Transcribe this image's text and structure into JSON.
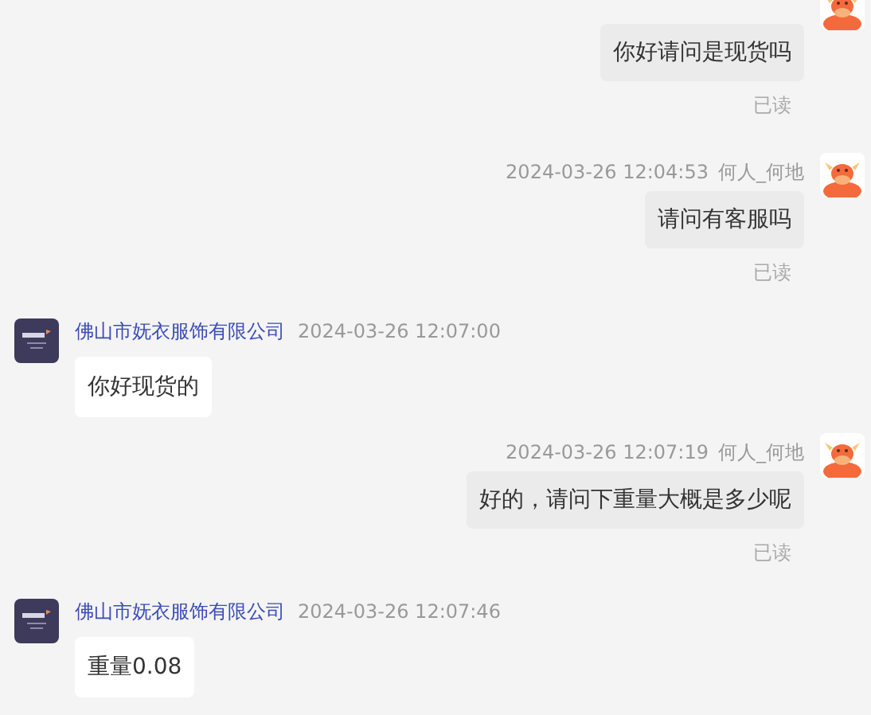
{
  "messages": [
    {
      "kind": "outgoing",
      "text": "你好请问是现货吗",
      "status": "已读"
    },
    {
      "kind": "outgoing",
      "time": "2024-03-26 12:04:53",
      "name": "何人_何地",
      "text": "请问有客服吗",
      "status": "已读"
    },
    {
      "kind": "incoming",
      "name": "佛山市妩衣服饰有限公司",
      "time": "2024-03-26 12:07:00",
      "text": "你好现货的"
    },
    {
      "kind": "outgoing",
      "time": "2024-03-26 12:07:19",
      "name": "何人_何地",
      "text": "好的，请问下重量大概是多少呢",
      "status": "已读"
    },
    {
      "kind": "incoming",
      "name": "佛山市妩衣服饰有限公司",
      "time": "2024-03-26 12:07:46",
      "text": "重量0.08"
    }
  ]
}
